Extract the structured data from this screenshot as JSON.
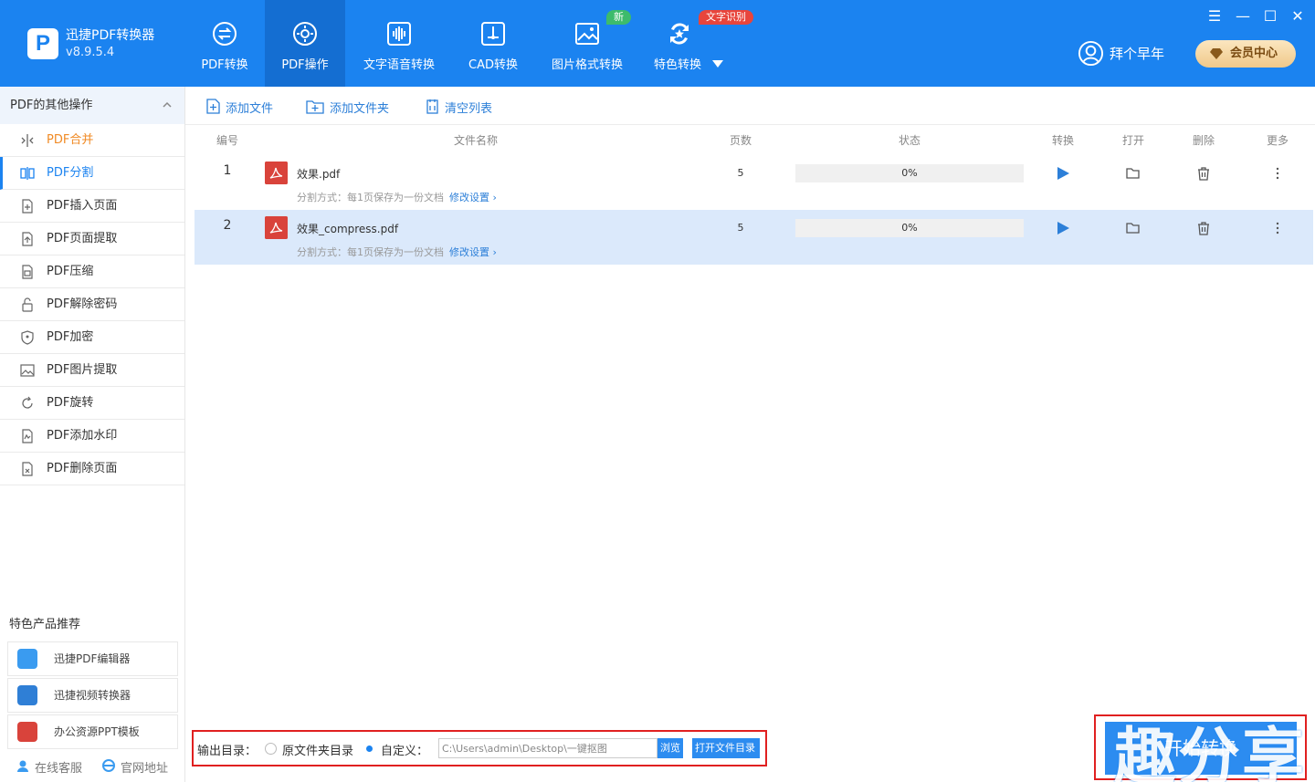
{
  "app": {
    "name": "迅捷PDF转换器",
    "version": "v8.9.5.4",
    "logo_letter": "P"
  },
  "nav": [
    {
      "label": "PDF转换",
      "icon": "convert-icon"
    },
    {
      "label": "PDF操作",
      "icon": "settings-icon"
    },
    {
      "label": "文字语音转换",
      "icon": "audio-wave-icon"
    },
    {
      "label": "CAD转换",
      "icon": "cad-icon"
    },
    {
      "label": "图片格式转换",
      "icon": "image-icon"
    },
    {
      "label": "特色转换",
      "icon": "star-convert-icon"
    }
  ],
  "badges": {
    "new": "新",
    "ocr": "文字识别"
  },
  "window": {
    "menu": "☰",
    "minimize": "—",
    "maximize": "☐",
    "close": "✕"
  },
  "user": {
    "greeting": "拜个早年",
    "vip": "会员中心"
  },
  "sidebar": {
    "title": "PDF的其他操作",
    "items": [
      {
        "label": "PDF合并",
        "icon": "merge-icon"
      },
      {
        "label": "PDF分割",
        "icon": "split-icon"
      },
      {
        "label": "PDF插入页面",
        "icon": "insert-page-icon"
      },
      {
        "label": "PDF页面提取",
        "icon": "extract-page-icon"
      },
      {
        "label": "PDF压缩",
        "icon": "compress-icon"
      },
      {
        "label": "PDF解除密码",
        "icon": "unlock-icon"
      },
      {
        "label": "PDF加密",
        "icon": "shield-icon"
      },
      {
        "label": "PDF图片提取",
        "icon": "picture-icon"
      },
      {
        "label": "PDF旋转",
        "icon": "rotate-icon"
      },
      {
        "label": "PDF添加水印",
        "icon": "watermark-icon"
      },
      {
        "label": "PDF删除页面",
        "icon": "delete-page-icon"
      }
    ],
    "rec_title": "特色产品推荐",
    "recommendations": [
      {
        "label": "迅捷PDF编辑器",
        "color": "#3a9bf0"
      },
      {
        "label": "迅捷视频转换器",
        "color": "#2f7fd6"
      },
      {
        "label": "办公资源PPT模板",
        "color": "#d9433b"
      }
    ],
    "footer": {
      "service": "在线客服",
      "website": "官网地址"
    }
  },
  "toolbar": {
    "add_file": "添加文件",
    "add_folder": "添加文件夹",
    "clear": "清空列表"
  },
  "columns": {
    "num": "编号",
    "name": "文件名称",
    "pages": "页数",
    "status": "状态",
    "convert": "转换",
    "open": "打开",
    "delete": "删除",
    "more": "更多"
  },
  "files": [
    {
      "num": "1",
      "name": "效果.pdf",
      "sub": "分割方式：每1页保存为一份文档",
      "link": "修改设置 ›",
      "pages": "5",
      "progress": "0%",
      "progress_value": 0
    },
    {
      "num": "2",
      "name": "效果_compress.pdf",
      "sub": "分割方式：每1页保存为一份文档",
      "link": "修改设置 ›",
      "pages": "5",
      "progress": "0%",
      "progress_value": 0
    }
  ],
  "output": {
    "label": "输出目录：",
    "opt_original": "原文件夹目录",
    "opt_custom": "自定义：",
    "path": "C:\\Users\\admin\\Desktop\\一键抠图",
    "browse": "浏览",
    "open_folder": "打开文件目录"
  },
  "start": {
    "label": "开始转换"
  },
  "watermark": "趣分享",
  "colors": {
    "brand": "#1b83f0",
    "active_tab": "#146ed2",
    "selected_row": "#dbe9fb",
    "accent_orange": "#f08a24",
    "highlight_border": "#e02020"
  }
}
